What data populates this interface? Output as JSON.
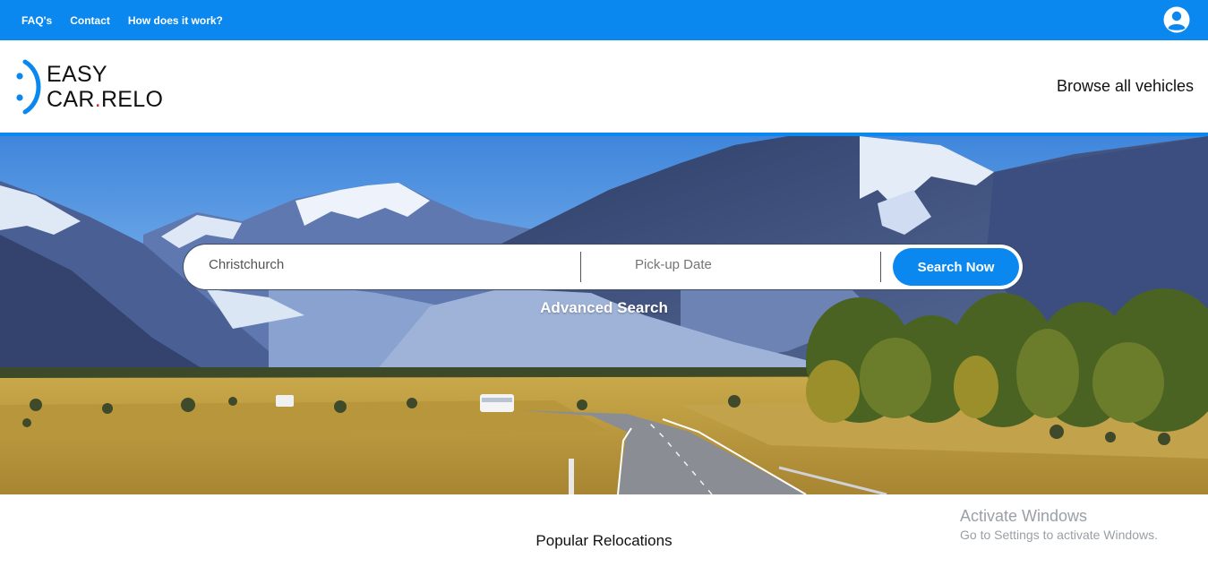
{
  "topbar": {
    "links": [
      "FAQ's",
      "Contact",
      "How does it work?"
    ],
    "user_icon": "user-circle-icon",
    "color": "#0a88ef"
  },
  "header": {
    "logo_line1": "EASY",
    "logo_line2a": "CAR",
    "logo_dot": ".",
    "logo_line2b": "RELO",
    "browse_label": "Browse all vehicles"
  },
  "search": {
    "location_value": "Christchurch",
    "date_placeholder": "Pick-up Date",
    "button_label": "Search Now",
    "advanced_label": "Advanced Search"
  },
  "main": {
    "popular_title": "Popular Relocations"
  },
  "watermark": {
    "line1": "Activate Windows",
    "line2": "Go to Settings to activate Windows."
  }
}
